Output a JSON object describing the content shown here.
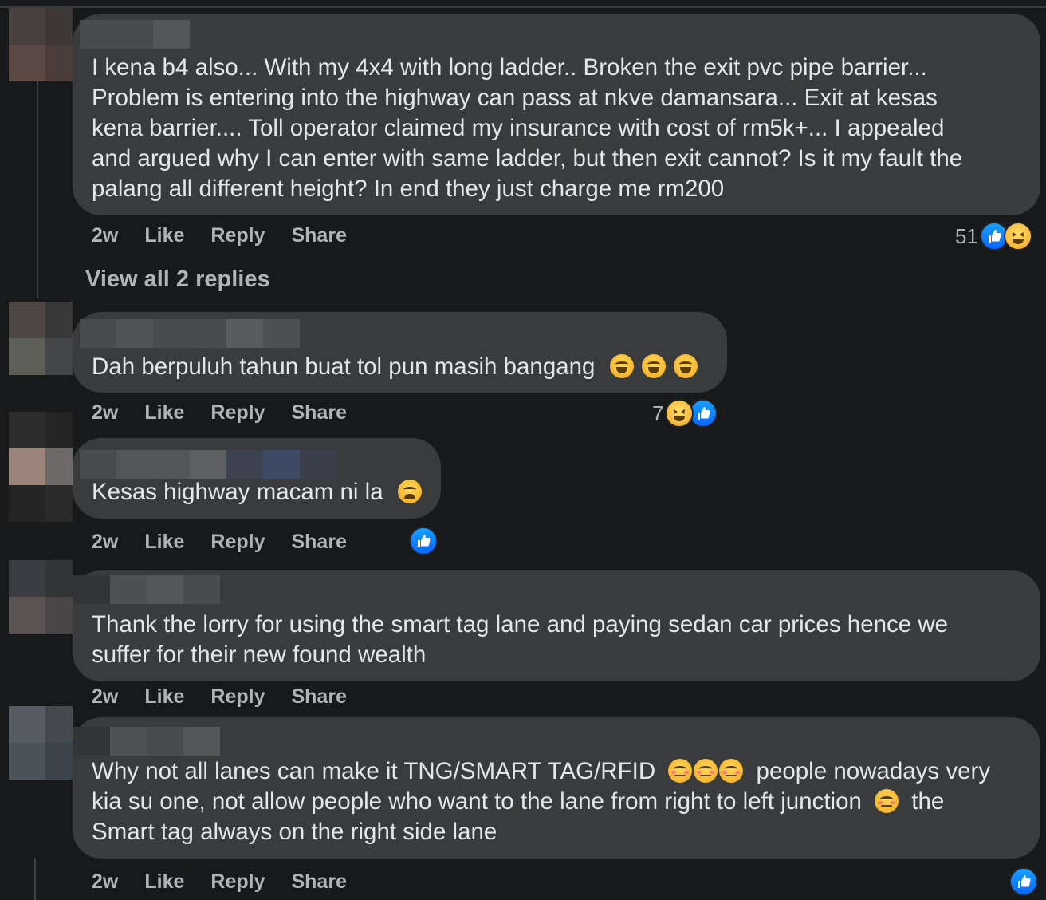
{
  "comments": [
    {
      "text_lines": [
        "I kena b4 also... With my 4x4 with long ladder.. Broken the exit pvc pipe barrier...",
        "Problem is entering into the highway can pass at nkve damansara... Exit at kesas",
        "kena barrier.... Toll operator claimed my insurance with cost of rm5k+... I appealed",
        "and argued why I can enter with same ladder, but then exit cannot? Is it my fault the",
        "palang all different height? In end they just charge me rm200"
      ],
      "time": "2w",
      "like": "Like",
      "reply": "Reply",
      "share": "Share",
      "reaction_count": "51",
      "reactions": [
        "like-icon",
        "haha-icon"
      ]
    },
    {
      "text": "Dah berpuluh tahun buat tol pun masih bangang",
      "emojis": [
        "rolling-laughing-emoji",
        "rolling-laughing-emoji",
        "rolling-laughing-emoji"
      ],
      "time": "2w",
      "like": "Like",
      "reply": "Reply",
      "share": "Share",
      "reaction_count": "7",
      "reactions": [
        "haha-icon",
        "like-icon"
      ]
    },
    {
      "text": "Kesas highway macam ni la",
      "emojis": [
        "weary-face-emoji"
      ],
      "time": "2w",
      "like": "Like",
      "reply": "Reply",
      "share": "Share",
      "reaction_count": "",
      "reactions": [
        "like-icon"
      ]
    },
    {
      "text_lines": [
        "Thank the lorry for using the smart tag lane and paying sedan car prices hence we",
        "suffer for their new found wealth"
      ],
      "time": "2w",
      "like": "Like",
      "reply": "Reply",
      "share": "Share"
    },
    {
      "line1_a": "Why not all lanes can make it TNG/SMART TAG/RFID",
      "line1_b": "people nowadays very",
      "line2_a": "kia su one, not allow people who want to the lane from right to left junction",
      "line2_b": "the",
      "line3": "Smart tag always on the right side lane",
      "emojis": [
        "flushed-face-emoji"
      ],
      "time": "2w",
      "like": "Like",
      "reply": "Reply",
      "share": "Share",
      "reactions": [
        "like-icon"
      ]
    }
  ],
  "view_replies": "View all 2 replies",
  "colors": {
    "background": "#18191a",
    "bubble": "#3a3b3c",
    "text": "#e4e6eb",
    "secondary": "#b0b3b8",
    "like_blue": "#0866ff"
  }
}
